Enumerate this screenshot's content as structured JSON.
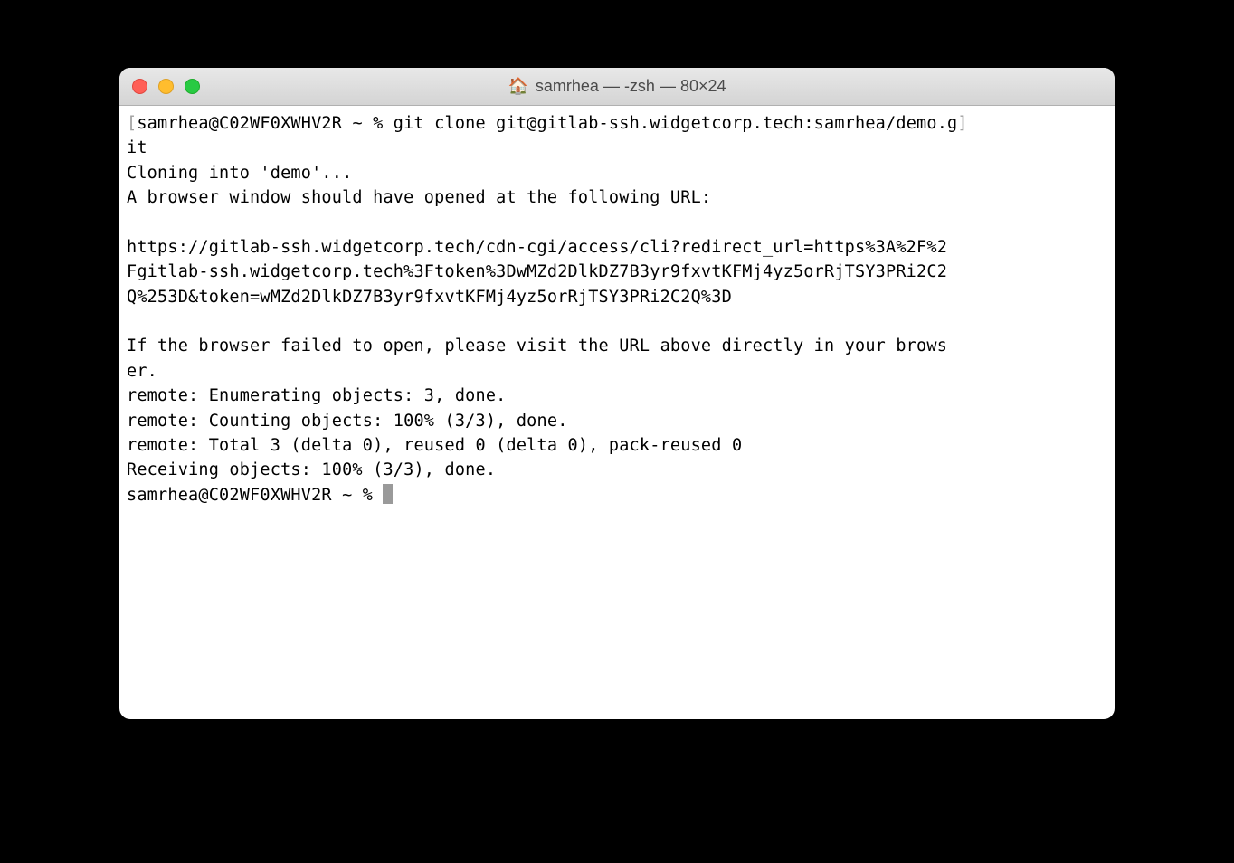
{
  "titlebar": {
    "icon": "🏠",
    "title": "samrhea — -zsh — 80×24"
  },
  "terminal": {
    "prompt1_prefix_bracket": "[",
    "prompt1_user": "samrhea@C02WF0XWHV2R ~ % ",
    "prompt1_command": "git clone git@gitlab-ssh.widgetcorp.tech:samrhea/demo.g",
    "prompt1_suffix_bracket": "]",
    "prompt1_command_wrap": "it",
    "line_cloning": "Cloning into 'demo'...",
    "line_browser": "A browser window should have opened at the following URL:",
    "url_line1": "https://gitlab-ssh.widgetcorp.tech/cdn-cgi/access/cli?redirect_url=https%3A%2F%2",
    "url_line2": "Fgitlab-ssh.widgetcorp.tech%3Ftoken%3DwMZd2DlkDZ7B3yr9fxvtKFMj4yz5orRjTSY3PRi2C2",
    "url_line3": "Q%253D&token=wMZd2DlkDZ7B3yr9fxvtKFMj4yz5orRjTSY3PRi2C2Q%3D",
    "line_fallback1": "If the browser failed to open, please visit the URL above directly in your brows",
    "line_fallback2": "er.",
    "line_remote1": "remote: Enumerating objects: 3, done.",
    "line_remote2": "remote: Counting objects: 100% (3/3), done.",
    "line_remote3": "remote: Total 3 (delta 0), reused 0 (delta 0), pack-reused 0",
    "line_receiving": "Receiving objects: 100% (3/3), done.",
    "prompt2": "samrhea@C02WF0XWHV2R ~ % "
  }
}
